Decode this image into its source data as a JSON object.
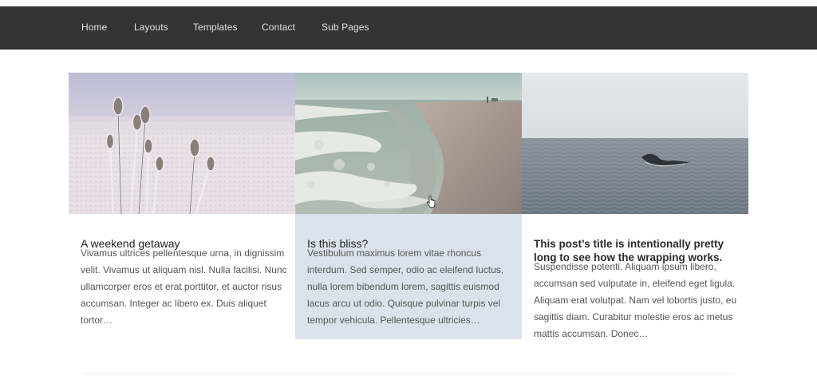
{
  "nav": {
    "items": [
      {
        "label": "Home"
      },
      {
        "label": "Layouts"
      },
      {
        "label": "Templates"
      },
      {
        "label": "Contact"
      },
      {
        "label": "Sub Pages"
      }
    ]
  },
  "posts": [
    {
      "title": "A weekend getaway",
      "excerpt": "Vivamus ultrices pellentesque urna, in dignissim velit. Vivamus ut aliquam nisl. Nulla facilisi. Nunc ullamcorper eros et erat porttitor, et auctor risus accumsan. Integer ac libero ex. Duis aliquet tortor…",
      "image": "frosted-thistles-photo"
    },
    {
      "title": "Is this bliss?",
      "excerpt": "Vestibulum maximus lorem vitae rhoncus interdum. Sed semper, odio ac eleifend luctus, nulla lorem bibendum lorem, sagittis euismod lacus arcu ut odio. Quisque pulvinar turpis vel tempor vehicula. Pellentesque ultricies…",
      "image": "beach-waves-photo"
    },
    {
      "title": "This post’s title is intentionally pretty long to see how the wrapping works.",
      "excerpt": "Suspendisse potenti. Aliquam ipsum libero, accumsan sed vulputate in, eleifend eget ligula. Aliquam erat volutpat. Nam vel lobortis justo, eu sagittis diam. Curabitur molestie eros ac metus mattis accumsan. Donec…",
      "image": "whale-tail-sea-photo"
    }
  ],
  "colors": {
    "nav_bg": "#333333",
    "nav_text": "#e2e2e2",
    "highlight_card": "#dae3eb",
    "title_text": "#222222",
    "body_text": "#555555"
  }
}
